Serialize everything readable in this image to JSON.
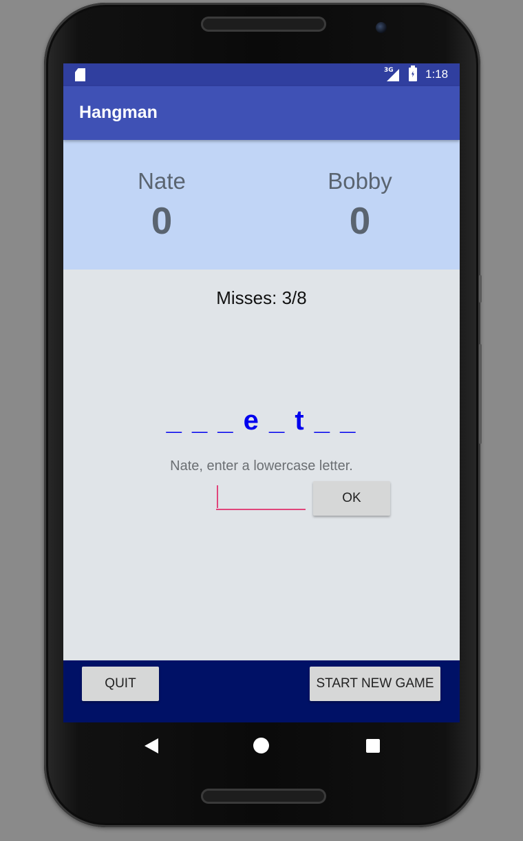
{
  "status_bar": {
    "network": "3G",
    "time": "1:18"
  },
  "app_bar": {
    "title": "Hangman"
  },
  "scoreboard": {
    "players": [
      {
        "name": "Nate",
        "score": "0"
      },
      {
        "name": "Bobby",
        "score": "0"
      }
    ]
  },
  "game": {
    "misses": "Misses: 3/8",
    "word_display": "_ _ _ e _ t _ _",
    "prompt": "Nate, enter a lowercase letter.",
    "input_value": "",
    "ok_label": "OK"
  },
  "bottom_bar": {
    "quit_label": "QUIT",
    "new_game_label": "START NEW GAME"
  },
  "nav": {
    "back_icon": "back-triangle-icon",
    "home_icon": "home-circle-icon",
    "recents_icon": "recents-square-icon"
  },
  "colors": {
    "status_bar": "#303f9f",
    "app_bar": "#3f51b5",
    "score_panel": "#c1d5f6",
    "word_text": "#0000ee",
    "input_underline": "#e0457b",
    "bottom_bar": "#001166"
  }
}
